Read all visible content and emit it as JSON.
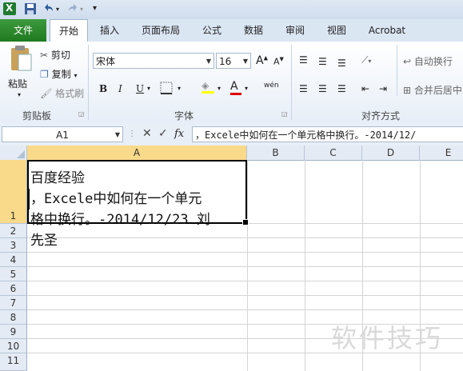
{
  "tabs": [
    "文件",
    "开始",
    "插入",
    "页面布局",
    "公式",
    "数据",
    "审阅",
    "视图",
    "Acrobat"
  ],
  "clipboard": {
    "paste": "粘贴",
    "cut": "剪切",
    "copy": "复制",
    "format_painter": "格式刷",
    "group": "剪贴板"
  },
  "font": {
    "name": "宋体",
    "size": "16",
    "grow": "A",
    "shrink": "A",
    "bold": "B",
    "italic": "I",
    "underline": "U",
    "font_color_letter": "A",
    "wen": "wén",
    "group": "字体"
  },
  "alignment": {
    "wrap": "自动换行",
    "merge": "合并后居中",
    "group": "对齐方式"
  },
  "formula_bar": {
    "name_box": "A1",
    "fx": "fx",
    "content": "，Excele中如何在一个单元格中换行。-2014/12/"
  },
  "columns": [
    "A",
    "B",
    "C",
    "D",
    "E"
  ],
  "rows": [
    "1",
    "2",
    "3",
    "4",
    "5",
    "6",
    "7",
    "8",
    "9",
    "10",
    "11"
  ],
  "cell_a1": {
    "line1": "百度经验",
    "line2": "，Excele中如何在一个单元",
    "line3": "格中换行。-2014/12/23 刘",
    "line4": "先圣"
  },
  "watermark": "软件技巧",
  "colors": {
    "file_tab": "#2a8a2a",
    "ribbon": "#e7eef7",
    "header": "#e4ebf4"
  }
}
